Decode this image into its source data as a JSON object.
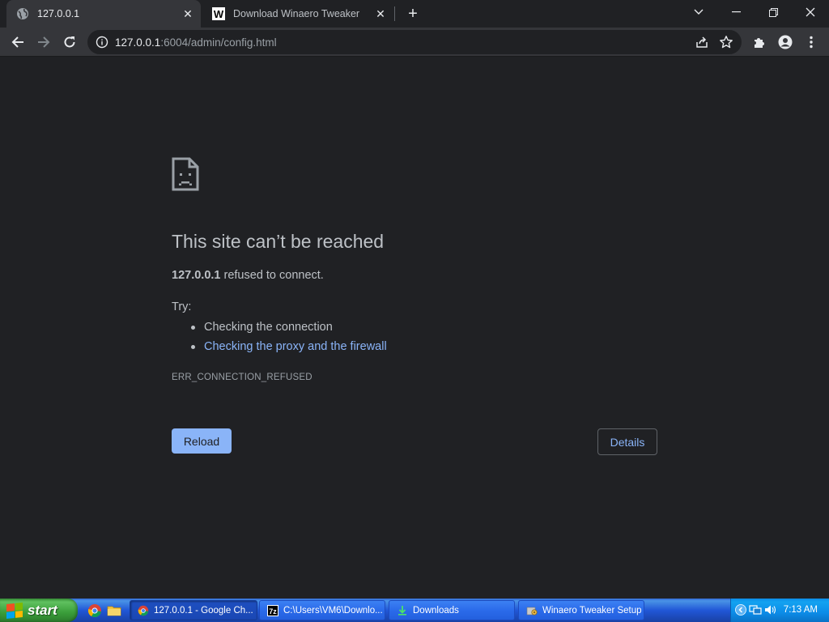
{
  "browser": {
    "tabs": [
      {
        "title": "127.0.0.1",
        "active": true
      },
      {
        "title": "Download Winaero Tweaker",
        "active": false
      }
    ],
    "url": {
      "host": "127.0.0.1",
      "rest": ":6004/admin/config.html"
    }
  },
  "error_page": {
    "heading": "This site can’t be reached",
    "host": "127.0.0.1",
    "refused_suffix": " refused to connect.",
    "try_label": "Try:",
    "suggestions": [
      "Checking the connection",
      "Checking the proxy and the firewall"
    ],
    "error_code": "ERR_CONNECTION_REFUSED",
    "reload_label": "Reload",
    "details_label": "Details"
  },
  "taskbar": {
    "start_label": "start",
    "tasks": [
      {
        "label": "127.0.0.1 - Google Ch...",
        "icon": "chrome-icon",
        "active": true
      },
      {
        "label": "C:\\Users\\VM6\\Downlo...",
        "icon": "7zip-icon",
        "active": false
      },
      {
        "label": "Downloads",
        "icon": "downloads-icon",
        "active": false
      },
      {
        "label": "Winaero Tweaker Setup",
        "icon": "setup-icon",
        "active": false
      }
    ],
    "clock": "7:13 AM"
  },
  "colors": {
    "page_bg": "#202124",
    "toolbar_bg": "#35363a",
    "link": "#8ab4f8",
    "text": "#bdc1c6"
  }
}
